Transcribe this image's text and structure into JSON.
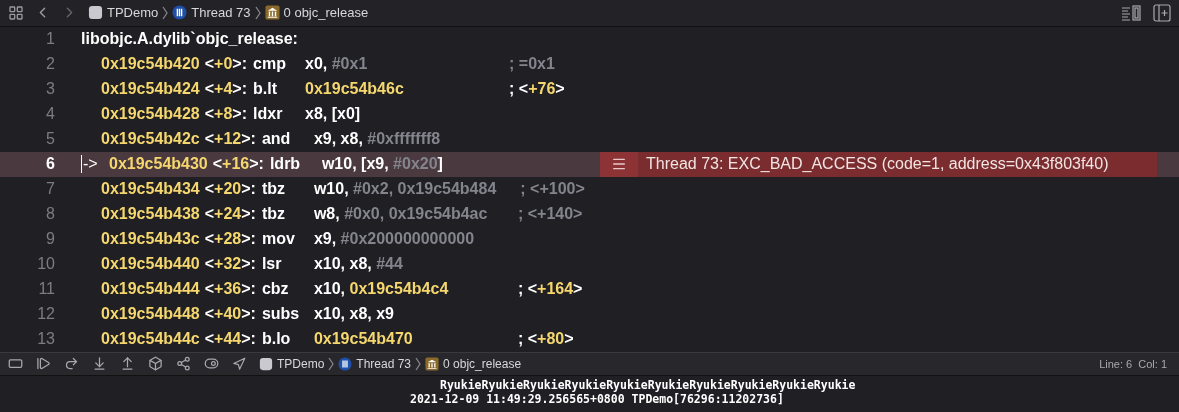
{
  "toolbar": {
    "breadcrumbs": [
      {
        "label": "TPDemo",
        "kind": "app"
      },
      {
        "label": "Thread 73",
        "kind": "thread"
      },
      {
        "label": "0 objc_release",
        "kind": "frame"
      }
    ]
  },
  "code": {
    "lines": [
      {
        "number": "1",
        "kind": "label",
        "selected": false,
        "text": "libobjc.A.dylib`objc_release:"
      },
      {
        "number": "2",
        "kind": "instruction",
        "selected": false,
        "address": "0x19c54b420",
        "offset": [
          {
            "text": "<",
            "kind": "plain"
          },
          {
            "text": "+0",
            "kind": "address"
          },
          {
            "text": ">:",
            "kind": "plain"
          }
        ],
        "mnemonic": "cmp",
        "operands": [
          {
            "text": "x0, ",
            "kind": "plain"
          },
          {
            "text": "#0x1",
            "kind": "immediate"
          }
        ],
        "comment": [
          {
            "text": "; =0x1",
            "kind": "immediate"
          }
        ]
      },
      {
        "number": "3",
        "kind": "instruction",
        "selected": false,
        "address": "0x19c54b424",
        "offset": [
          {
            "text": "<",
            "kind": "plain"
          },
          {
            "text": "+4",
            "kind": "address"
          },
          {
            "text": ">:",
            "kind": "plain"
          }
        ],
        "mnemonic": "b.lt",
        "operands": [
          {
            "text": "0x19c54b46c",
            "kind": "address"
          }
        ],
        "comment": [
          {
            "text": "; <",
            "kind": "plain"
          },
          {
            "text": "+76",
            "kind": "address"
          },
          {
            "text": ">",
            "kind": "plain"
          }
        ]
      },
      {
        "number": "4",
        "kind": "instruction",
        "selected": false,
        "address": "0x19c54b428",
        "offset": [
          {
            "text": "<",
            "kind": "plain"
          },
          {
            "text": "+8",
            "kind": "address"
          },
          {
            "text": ">:",
            "kind": "plain"
          }
        ],
        "mnemonic": "ldxr",
        "operands": [
          {
            "text": "x8, [x0]",
            "kind": "plain"
          }
        ]
      },
      {
        "number": "5",
        "kind": "instruction",
        "selected": false,
        "address": "0x19c54b42c",
        "offset": [
          {
            "text": "<",
            "kind": "plain"
          },
          {
            "text": "+12",
            "kind": "address"
          },
          {
            "text": ">:",
            "kind": "plain"
          }
        ],
        "mnemonic": "and",
        "operands": [
          {
            "text": "x9, x8, ",
            "kind": "plain"
          },
          {
            "text": "#0xfffffff8",
            "kind": "immediate"
          }
        ]
      },
      {
        "number": "6",
        "kind": "instruction",
        "selected": true,
        "marker": "->",
        "address": "0x19c54b430",
        "offset": [
          {
            "text": "<",
            "kind": "plain"
          },
          {
            "text": "+16",
            "kind": "address"
          },
          {
            "text": ">:",
            "kind": "plain"
          }
        ],
        "mnemonic": "ldrb",
        "operands": [
          {
            "text": "w10, [x9, ",
            "kind": "plain"
          },
          {
            "text": "#0x20",
            "kind": "immediate"
          },
          {
            "text": "]",
            "kind": "plain"
          }
        ],
        "annotation": "Thread 73: EXC_BAD_ACCESS (code=1, address=0x43f803f40)"
      },
      {
        "number": "7",
        "kind": "instruction",
        "selected": false,
        "address": "0x19c54b434",
        "offset": [
          {
            "text": "<",
            "kind": "plain"
          },
          {
            "text": "+20",
            "kind": "address"
          },
          {
            "text": ">:",
            "kind": "plain"
          }
        ],
        "mnemonic": "tbz",
        "operands": [
          {
            "text": "w10, ",
            "kind": "plain"
          },
          {
            "text": "#0x2, 0x19c54b484",
            "kind": "immediate"
          }
        ],
        "comment": [
          {
            "text": "; <+100>",
            "kind": "immediate"
          }
        ]
      },
      {
        "number": "8",
        "kind": "instruction",
        "selected": false,
        "address": "0x19c54b438",
        "offset": [
          {
            "text": "<",
            "kind": "plain"
          },
          {
            "text": "+24",
            "kind": "address"
          },
          {
            "text": ">:",
            "kind": "plain"
          }
        ],
        "mnemonic": "tbz",
        "operands": [
          {
            "text": "w8, ",
            "kind": "plain"
          },
          {
            "text": "#0x0, 0x19c54b4ac",
            "kind": "immediate"
          }
        ],
        "comment": [
          {
            "text": "; <+140>",
            "kind": "immediate"
          }
        ]
      },
      {
        "number": "9",
        "kind": "instruction",
        "selected": false,
        "address": "0x19c54b43c",
        "offset": [
          {
            "text": "<",
            "kind": "plain"
          },
          {
            "text": "+28",
            "kind": "address"
          },
          {
            "text": ">:",
            "kind": "plain"
          }
        ],
        "mnemonic": "mov",
        "operands": [
          {
            "text": "x9, ",
            "kind": "plain"
          },
          {
            "text": "#0x200000000000",
            "kind": "immediate"
          }
        ]
      },
      {
        "number": "10",
        "kind": "instruction",
        "selected": false,
        "address": "0x19c54b440",
        "offset": [
          {
            "text": "<",
            "kind": "plain"
          },
          {
            "text": "+32",
            "kind": "address"
          },
          {
            "text": ">:",
            "kind": "plain"
          }
        ],
        "mnemonic": "lsr",
        "operands": [
          {
            "text": "x10, x8, ",
            "kind": "plain"
          },
          {
            "text": "#44",
            "kind": "immediate"
          }
        ]
      },
      {
        "number": "11",
        "kind": "instruction",
        "selected": false,
        "address": "0x19c54b444",
        "offset": [
          {
            "text": "<",
            "kind": "plain"
          },
          {
            "text": "+36",
            "kind": "address"
          },
          {
            "text": ">:",
            "kind": "plain"
          }
        ],
        "mnemonic": "cbz",
        "operands": [
          {
            "text": "x10, ",
            "kind": "plain"
          },
          {
            "text": "0x19c54b4c4",
            "kind": "address"
          }
        ],
        "comment": [
          {
            "text": "; <",
            "kind": "plain"
          },
          {
            "text": "+164",
            "kind": "address"
          },
          {
            "text": ">",
            "kind": "plain"
          }
        ]
      },
      {
        "number": "12",
        "kind": "instruction",
        "selected": false,
        "address": "0x19c54b448",
        "offset": [
          {
            "text": "<",
            "kind": "plain"
          },
          {
            "text": "+40",
            "kind": "address"
          },
          {
            "text": ">:",
            "kind": "plain"
          }
        ],
        "mnemonic": "subs",
        "operands": [
          {
            "text": "x10, x8, x9",
            "kind": "plain"
          }
        ]
      },
      {
        "number": "13",
        "kind": "instruction",
        "selected": false,
        "address": "0x19c54b44c",
        "offset": [
          {
            "text": "<",
            "kind": "plain"
          },
          {
            "text": "+44",
            "kind": "address"
          },
          {
            "text": ">:",
            "kind": "plain"
          }
        ],
        "mnemonic": "b.lo",
        "operands": [
          {
            "text": "0x19c54b470",
            "kind": "address"
          }
        ],
        "comment": [
          {
            "text": "; <",
            "kind": "plain"
          },
          {
            "text": "+80",
            "kind": "address"
          },
          {
            "text": ">",
            "kind": "plain"
          }
        ]
      }
    ]
  },
  "debug_bar": {
    "breadcrumbs": [
      {
        "label": "TPDemo",
        "kind": "app"
      },
      {
        "label": "Thread 73",
        "kind": "thread"
      },
      {
        "label": "0 objc_release",
        "kind": "frame"
      }
    ],
    "position": "Line: 6  Col: 1"
  },
  "console": {
    "lines": [
      "RyukieRyukieRyukieRyukieRyukieRyukieRyukieRyukieRyukieRyukie",
      "2021-12-09 11:49:29.256565+0800 TPDemo[76296:11202736]"
    ]
  }
}
